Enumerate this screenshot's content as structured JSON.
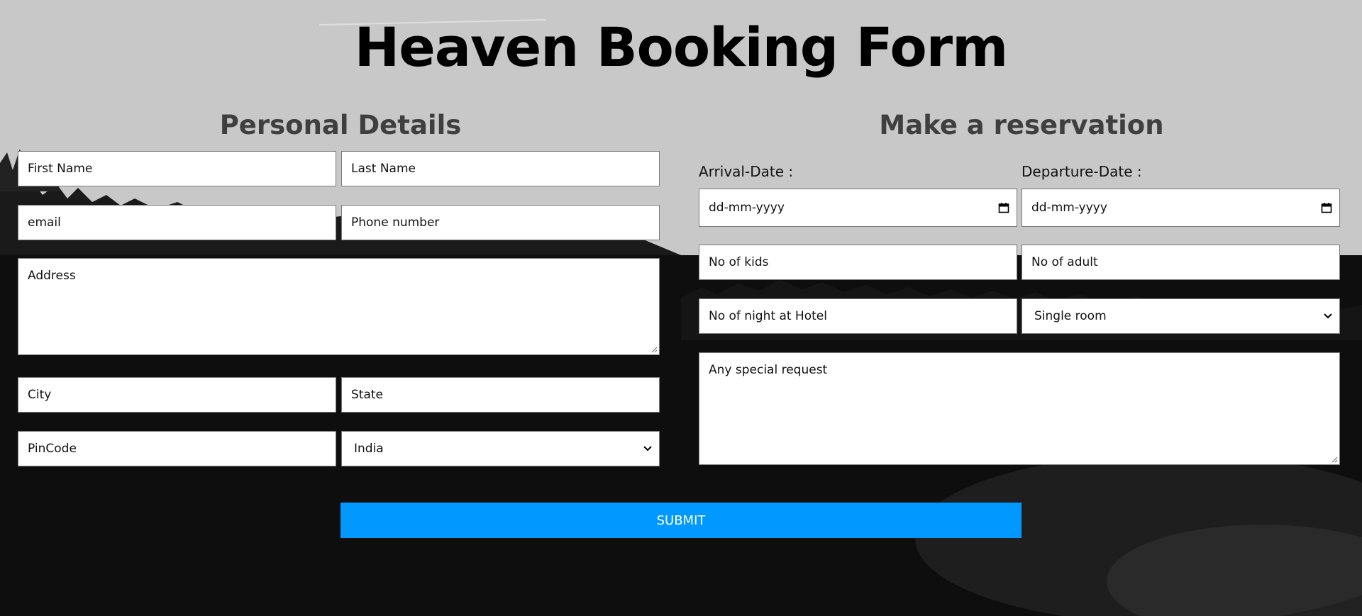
{
  "title": "Heaven Booking Form",
  "personal": {
    "heading": "Personal Details",
    "first_name": "First Name",
    "last_name": "Last Name",
    "email": "email",
    "phone": "Phone number",
    "address": "Address",
    "city": "City",
    "state": "State",
    "pincode": "PinCode",
    "country": "India"
  },
  "reservation": {
    "heading": "Make a reservation",
    "arrival_label": "Arrival-Date :",
    "departure_label": "Departure-Date :",
    "arrival_value": "dd-mm-yyyy",
    "departure_value": "dd-mm-yyyy",
    "kids": "No of kids",
    "adult": "No of adult",
    "nights": "No of night at Hotel",
    "room_type": "Single room",
    "special_request": "Any special request"
  },
  "submit_label": "SUBMIT",
  "colors": {
    "accent": "#0199ff",
    "heading": "#3f3f3f"
  },
  "icons": [
    "calendar-icon",
    "chevron-down-icon",
    "resize-handle-icon"
  ]
}
